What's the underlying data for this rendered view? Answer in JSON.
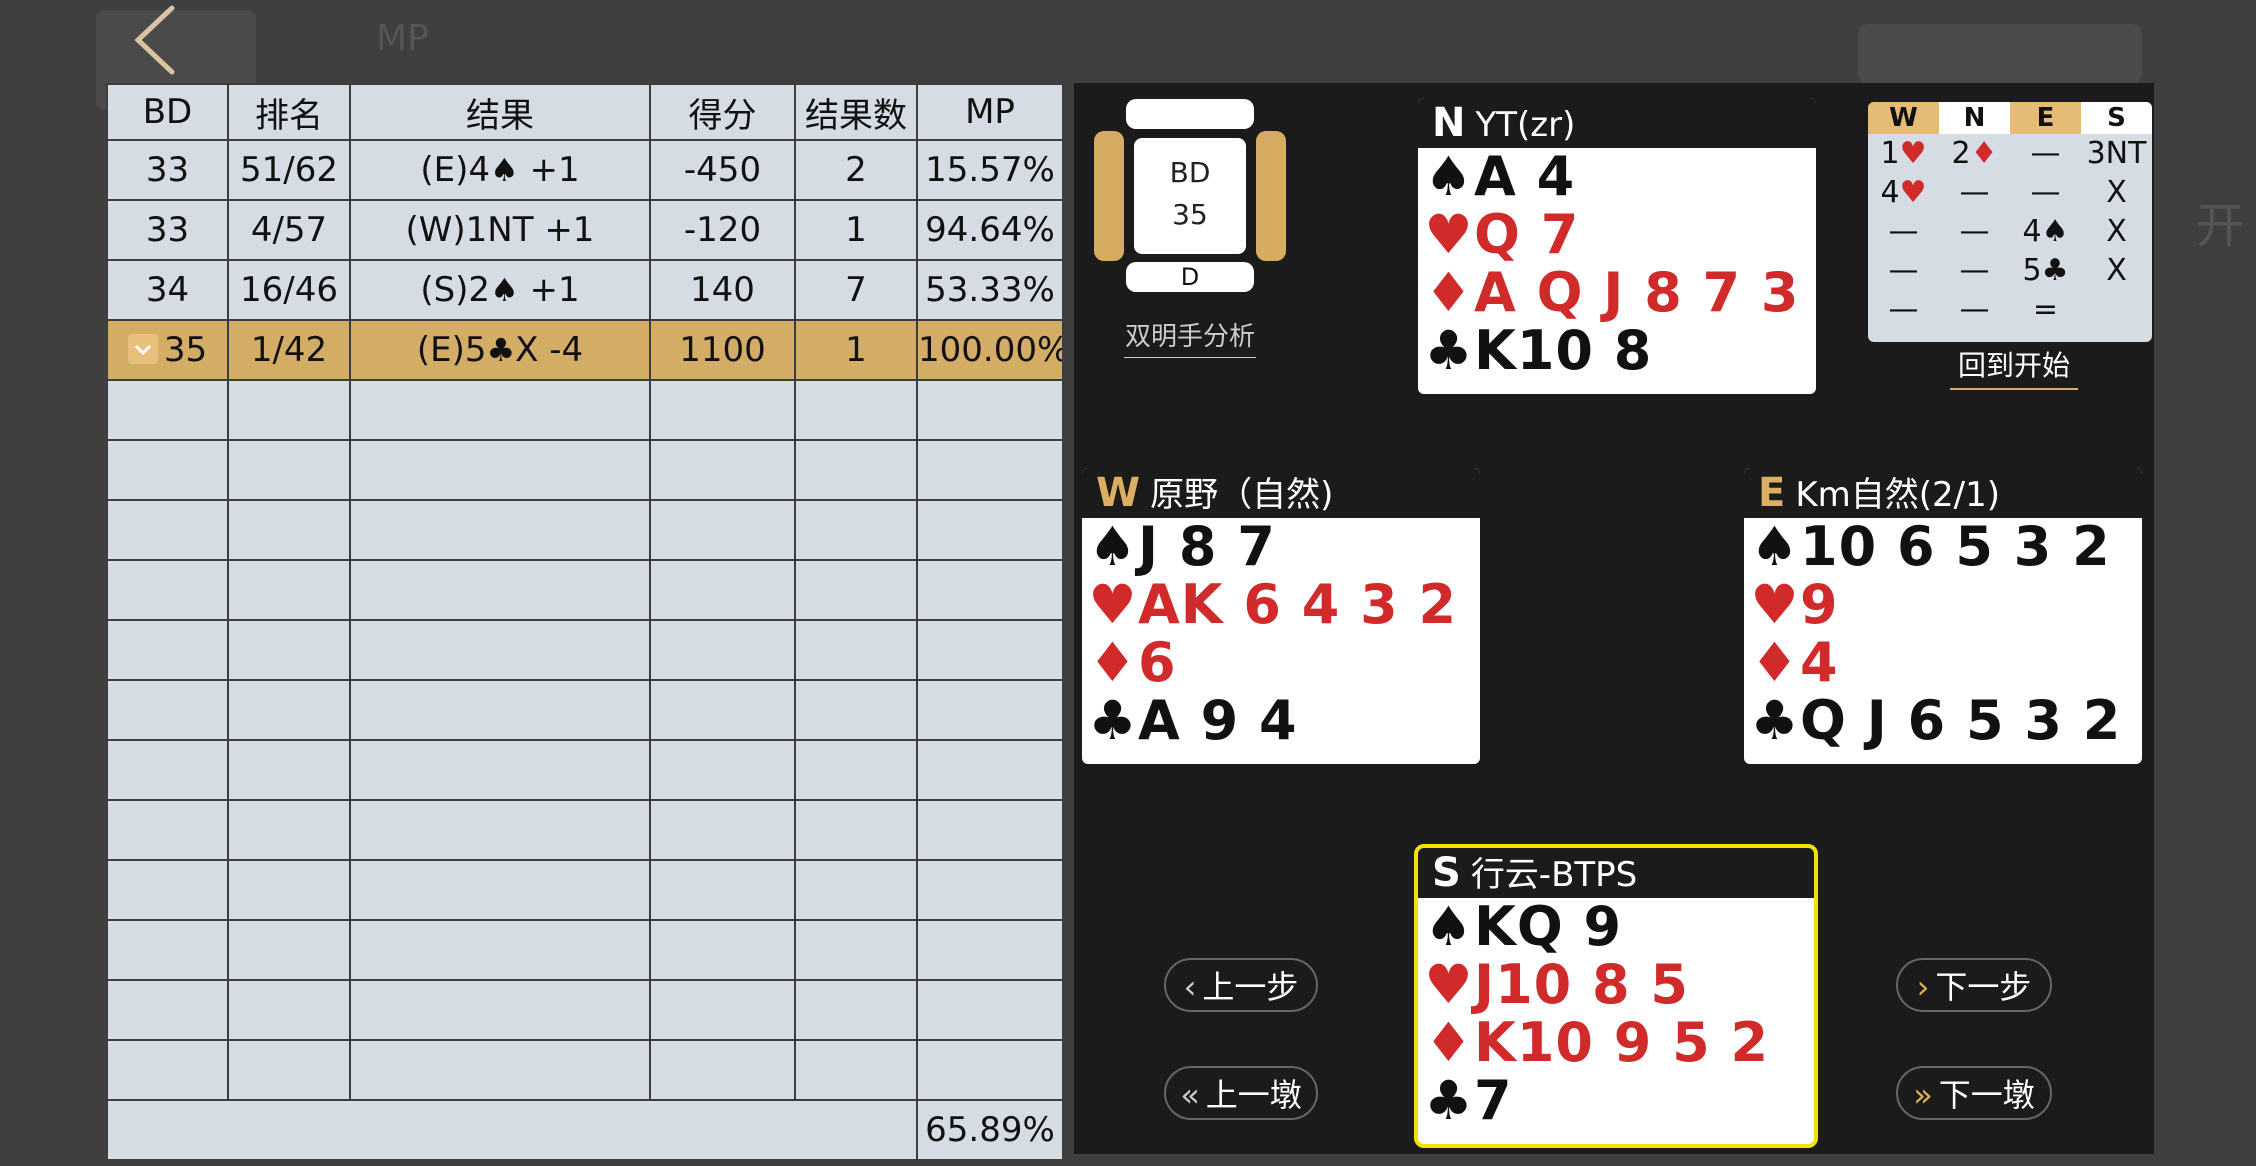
{
  "background": {
    "ghost_mp": "MP",
    "ghost_kai": "开"
  },
  "table": {
    "headers": [
      "BD",
      "排名",
      "结果",
      "得分",
      "结果数",
      "MP"
    ],
    "rows": [
      {
        "bd": "33",
        "rank": "51/62",
        "result_decl": "(E)4",
        "result_suit": "♠",
        "result_tail": " +1",
        "suit_color": "black",
        "score": "-450",
        "count": "2",
        "mp": "15.57%"
      },
      {
        "bd": "33",
        "rank": "4/57",
        "result_decl": "(W)1NT +1",
        "result_suit": "",
        "result_tail": "",
        "suit_color": "black",
        "score": "-120",
        "count": "1",
        "mp": "94.64%"
      },
      {
        "bd": "34",
        "rank": "16/46",
        "result_decl": "(S)2",
        "result_suit": "♠",
        "result_tail": " +1",
        "suit_color": "black",
        "score": "140",
        "count": "7",
        "mp": "53.33%"
      },
      {
        "bd": "35",
        "rank": "1/42",
        "result_decl": "(E)5",
        "result_suit": "♣",
        "result_tail": "X -4",
        "suit_color": "black",
        "score": "1100",
        "count": "1",
        "mp": "100.00%"
      }
    ],
    "summary_mp": "65.89%"
  },
  "board": {
    "label": "BD",
    "number": "35",
    "dealer": "D",
    "double_dummy": "双明手分析"
  },
  "hands": {
    "north": {
      "seat": "N",
      "name": "YT(zr)",
      "spades": "A 4",
      "hearts": "Q 7",
      "diamonds": "A Q J 8 7 3",
      "clubs": "K10 8"
    },
    "west": {
      "seat": "W",
      "name": "原野（自然)",
      "spades": "J 8 7",
      "hearts": "AK 6 4 3 2",
      "diamonds": "6",
      "clubs": "A 9 4"
    },
    "east": {
      "seat": "E",
      "name": "Km自然(2/1)",
      "spades": "10 6 5 3 2",
      "hearts": "9",
      "diamonds": "4",
      "clubs": "Q J 6 5 3 2"
    },
    "south": {
      "seat": "S",
      "name": "行云-BTPS",
      "spades": "KQ 9",
      "hearts": "J10 8 5",
      "diamonds": "K10 9 5 2",
      "clubs": "7"
    }
  },
  "suits": {
    "spade": "♠",
    "heart": "♥",
    "diamond": "♦",
    "club": "♣"
  },
  "bidding": {
    "headers": [
      "W",
      "N",
      "E",
      "S"
    ],
    "rows": [
      [
        "1♥",
        "2♦",
        "—",
        "3NT"
      ],
      [
        "4♥",
        "—",
        "—",
        "X"
      ],
      [
        "—",
        "—",
        "4♠",
        "X"
      ],
      [
        "—",
        "—",
        "5♣",
        "X"
      ],
      [
        "—",
        "—",
        "=",
        ""
      ]
    ],
    "back_to_start": "回到开始"
  },
  "nav": {
    "prev_step": "上一步",
    "prev_trick": "上一墩",
    "next_step": "下一步",
    "next_trick": "下一墩"
  },
  "colors": {
    "gold": "#d6ac62",
    "red": "#d12a2a",
    "highlight": "#d3ac66",
    "south_border": "#f3e200"
  }
}
